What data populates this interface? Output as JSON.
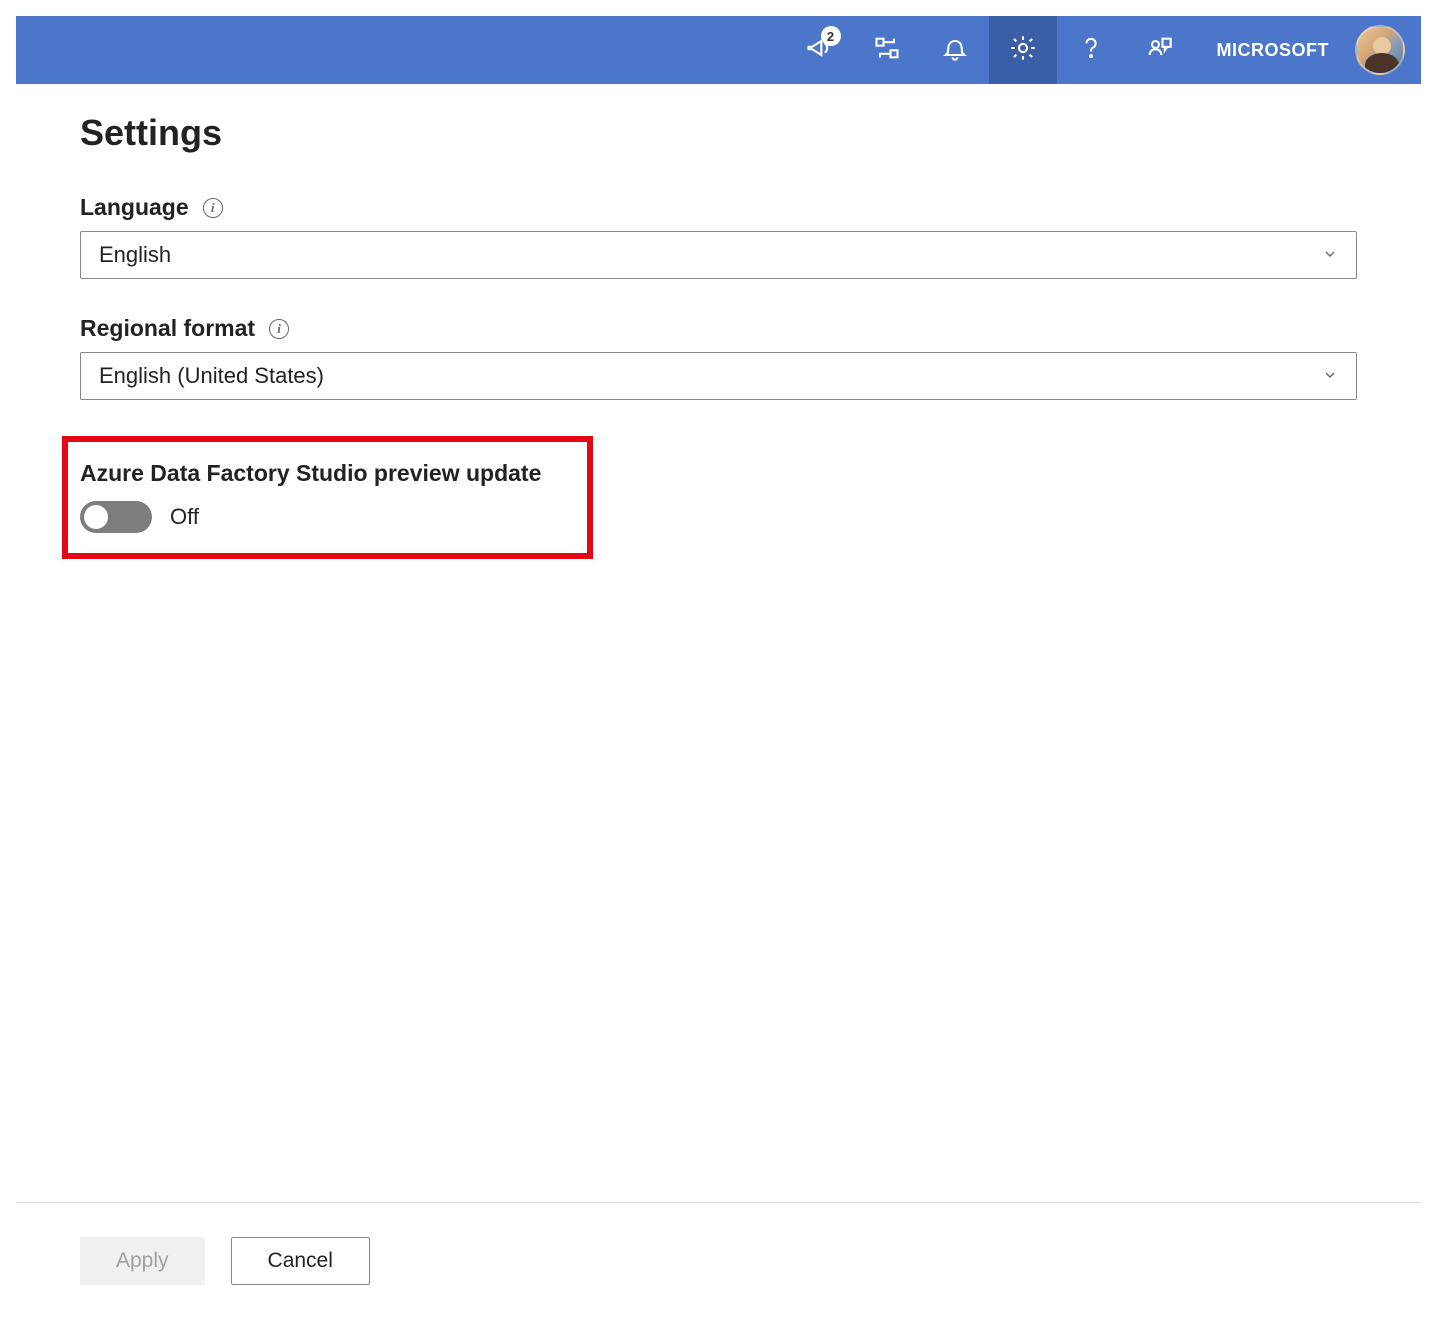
{
  "header": {
    "badge_count": "2",
    "tenant": "MICROSOFT"
  },
  "page": {
    "title": "Settings",
    "language_label": "Language",
    "language_value": "English",
    "regional_label": "Regional format",
    "regional_value": "English (United States)",
    "preview_label": "Azure Data Factory Studio preview update",
    "preview_toggle_state": "Off"
  },
  "footer": {
    "apply": "Apply",
    "cancel": "Cancel"
  },
  "icons": {
    "megaphone": "megaphone-icon",
    "pipeline": "pipeline-icon",
    "bell": "bell-icon",
    "gear": "gear-icon",
    "help": "help-icon",
    "feedback": "feedback-icon"
  }
}
